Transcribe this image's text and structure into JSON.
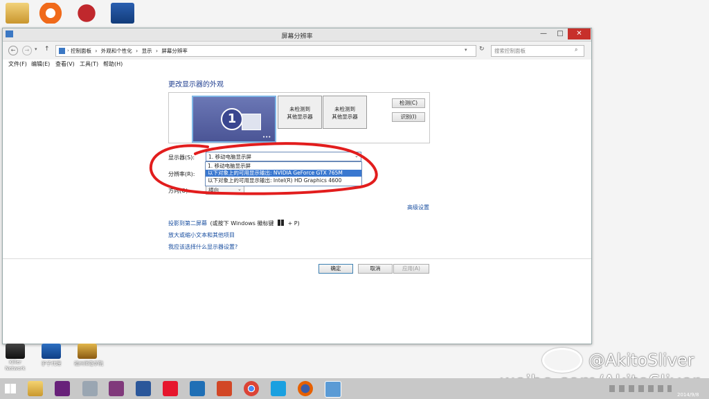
{
  "desktop": {
    "bottom_icons": [
      {
        "label": "Killer Network"
      },
      {
        "label": "驴子代理"
      },
      {
        "label": "福州师范学院"
      }
    ]
  },
  "window": {
    "title": "屏幕分辨率",
    "controls": {
      "minimize": "—",
      "maximize": "□",
      "close": "✕"
    },
    "breadcrumb": [
      "控制面板",
      "外观和个性化",
      "显示",
      "屏幕分辨率"
    ],
    "breadcrumb_sep": "›",
    "search_placeholder": "搜索控制面板",
    "menu": [
      "文件(F)",
      "编辑(E)",
      "查看(V)",
      "工具(T)",
      "帮助(H)"
    ],
    "heading": "更改显示器的外观",
    "monitors": [
      {
        "number": "1"
      },
      {
        "line1": "未检测到",
        "line2": "其他显示器"
      },
      {
        "line1": "未检测到",
        "line2": "其他显示器"
      }
    ],
    "detect_label": "检测(C)",
    "identify_label": "识别(I)",
    "display_label": "显示器(S):",
    "display_value": "1. 移动电脑显示屏",
    "display_options": [
      "1. 移动电脑显示屏",
      "以下对象上的可用显示输出: NVIDIA GeForce GTX 765M",
      "以下对象上的可用显示输出: Intel(R) HD Graphics 4600"
    ],
    "resolution_label": "分辨率(R):",
    "orientation_label": "方向(O):",
    "orientation_value": "横向",
    "advanced_link": "高级设置",
    "project_link": "投影到第二屏幕",
    "project_hint_pre": "(或按下 Windows 徽标键",
    "project_hint_post": "+ P)",
    "text_size_link": "放大或缩小文本和其他项目",
    "which_settings_link": "我应该选择什么显示器设置?",
    "ok_label": "确定",
    "cancel_label": "取消",
    "apply_label": "应用(A)"
  },
  "watermark": {
    "handle": "@AkitoSliver",
    "url": "weibo.com/AkitoSliver"
  },
  "taskbar": {
    "date": "2014/9/8"
  }
}
